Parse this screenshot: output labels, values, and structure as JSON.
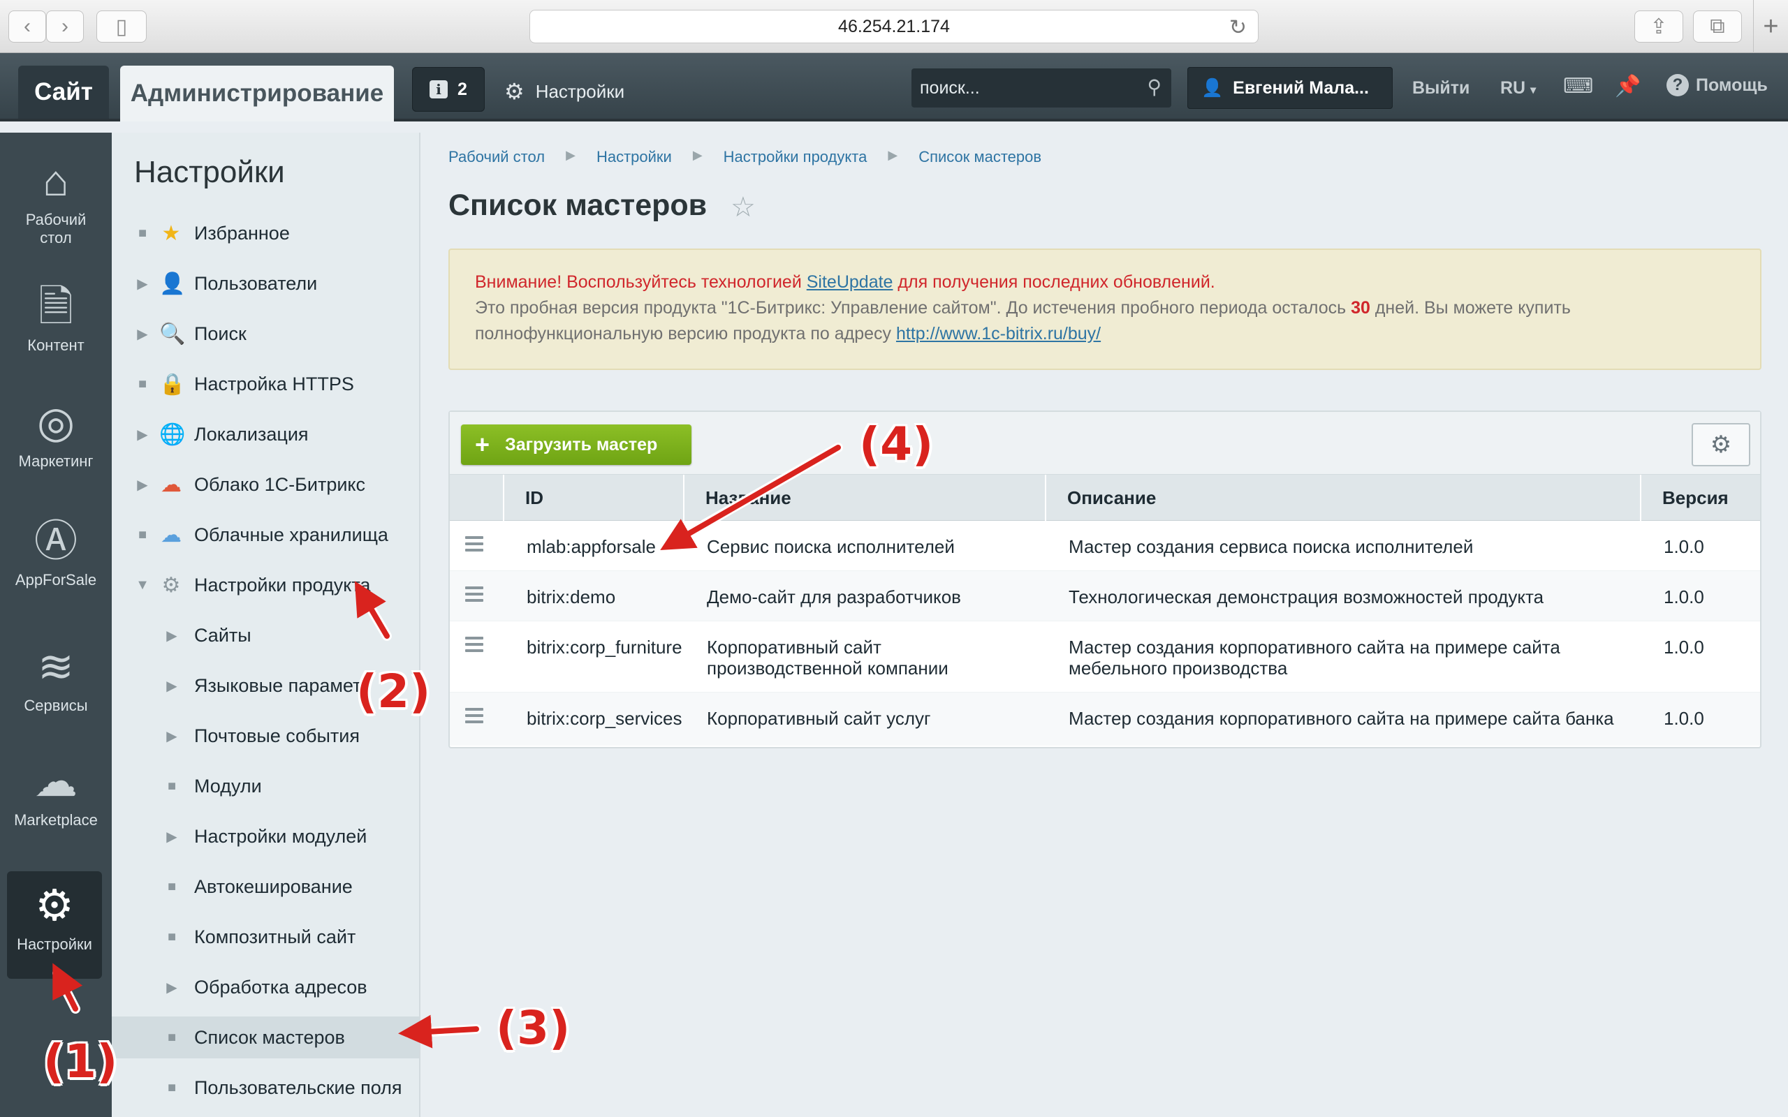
{
  "browser": {
    "url": "46.254.21.174"
  },
  "topbar": {
    "site_tab": "Сайт",
    "admin_tab": "Администрирование",
    "notifications_count": "2",
    "settings_label": "Настройки",
    "search_placeholder": "поиск...",
    "user_name": "Евгений Мала...",
    "logout": "Выйти",
    "lang": "RU",
    "help": "Помощь"
  },
  "iconbar": {
    "items": [
      {
        "label": "Рабочий стол",
        "icon": "home-icon"
      },
      {
        "label": "Контент",
        "icon": "document-icon"
      },
      {
        "label": "Маркетинг",
        "icon": "target-icon"
      },
      {
        "label": "AppForSale",
        "icon": "appforsale-icon"
      },
      {
        "label": "Сервисы",
        "icon": "layers-icon"
      },
      {
        "label": "Marketplace",
        "icon": "cloud-download-icon"
      },
      {
        "label": "Настройки",
        "icon": "gear-icon"
      }
    ]
  },
  "menu": {
    "title": "Настройки",
    "items": [
      {
        "label": "Избранное"
      },
      {
        "label": "Пользователи"
      },
      {
        "label": "Поиск"
      },
      {
        "label": "Настройка HTTPS"
      },
      {
        "label": "Локализация"
      },
      {
        "label": "Облако 1С-Битрикс"
      },
      {
        "label": "Облачные хранилища"
      },
      {
        "label": "Настройки продукта"
      },
      {
        "label": "Сайты"
      },
      {
        "label": "Языковые парамет"
      },
      {
        "label": "Почтовые события"
      },
      {
        "label": "Модули"
      },
      {
        "label": "Настройки модулей"
      },
      {
        "label": "Автокеширование"
      },
      {
        "label": "Композитный сайт"
      },
      {
        "label": "Обработка адресов"
      },
      {
        "label": "Список мастеров"
      },
      {
        "label": "Пользовательские поля"
      }
    ]
  },
  "breadcrumbs": [
    "Рабочий стол",
    "Настройки",
    "Настройки продукта",
    "Список мастеров"
  ],
  "page": {
    "title": "Список мастеров"
  },
  "notice": {
    "warn_prefix": "Внимание! Воспользуйтесь технологией",
    "link": "SiteUpdate",
    "warn_suffix": "для получения последних обновлений.",
    "line2_a": "Это пробная версия продукта \"1С-Битрикс: Управление сайтом\". До истечения пробного периода осталось",
    "days": "30",
    "line2_b": "дней. Вы можете купить",
    "line3": "полнофункциональную версию продукта по адресу",
    "buy_link": "http://www.1c-bitrix.ru/buy/"
  },
  "grid": {
    "add_button": "Загрузить мастер",
    "columns": [
      "ID",
      "Название",
      "Описание",
      "Версия"
    ],
    "rows": [
      {
        "id": "mlab:appforsale",
        "name": "Сервис поиска исполнителей",
        "description": "Мастер создания сервиса поиска исполнителей",
        "version": "1.0.0"
      },
      {
        "id": "bitrix:demo",
        "name": "Демо-сайт для разработчиков",
        "description": "Технологическая демонстрация возможностей продукта",
        "version": "1.0.0"
      },
      {
        "id": "bitrix:corp_furniture",
        "name": "Корпоративный сайт производственной компании",
        "description": "Мастер создания корпоративного сайта на примере сайта мебельного производства",
        "version": "1.0.0"
      },
      {
        "id": "bitrix:corp_services",
        "name": "Корпоративный сайт услуг",
        "description": "Мастер создания корпоративного сайта на примере сайта банка",
        "version": "1.0.0"
      }
    ]
  },
  "annotations": [
    "(1)",
    "(2)",
    "(3)",
    "(4)"
  ],
  "colors": {
    "accent_red": "#d9231e",
    "link_blue": "#2e74a3",
    "button_green": "#7bb11c",
    "sidebar_dark": "#3c4950"
  }
}
